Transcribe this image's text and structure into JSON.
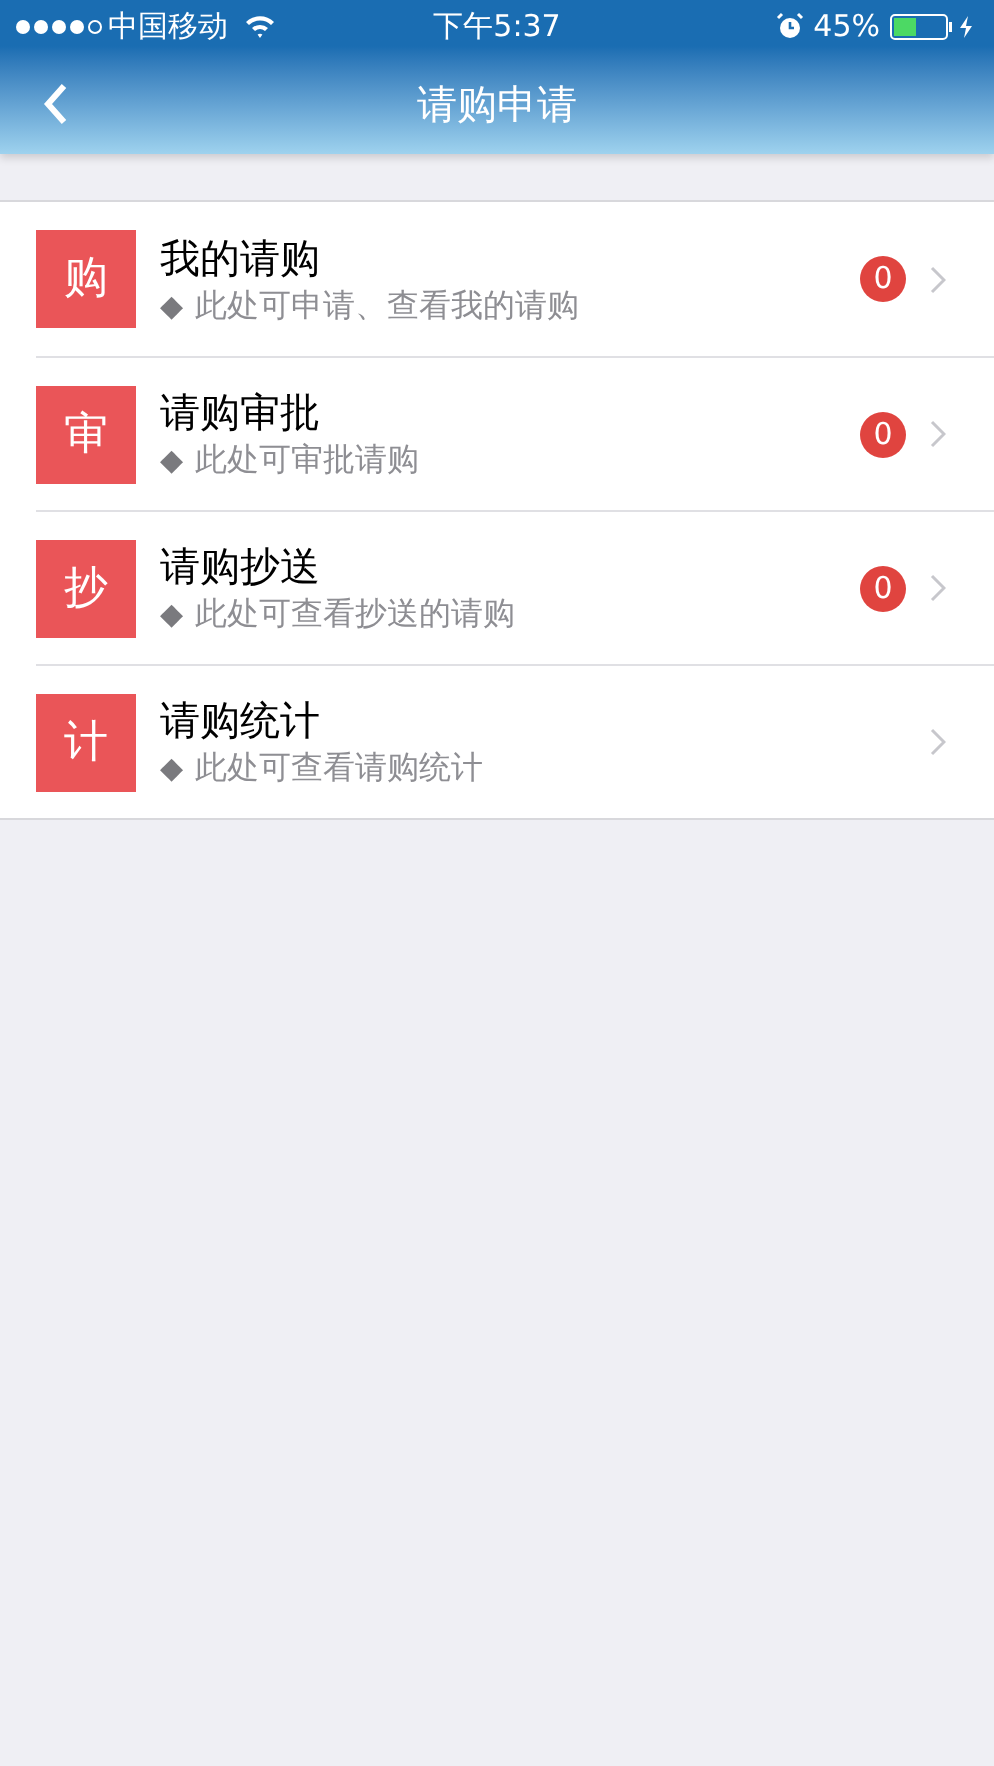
{
  "status_bar": {
    "carrier": "中国移动",
    "time": "下午5:37",
    "battery": "45%"
  },
  "nav_bar": {
    "title": "请购申请"
  },
  "items": [
    {
      "icon_char": "购",
      "title": "我的请购",
      "marker": "◆",
      "subtitle": "此处可申请、查看我的请购",
      "badge": "0"
    },
    {
      "icon_char": "审",
      "title": "请购审批",
      "marker": "◆",
      "subtitle": "此处可审批请购",
      "badge": "0"
    },
    {
      "icon_char": "抄",
      "title": "请购抄送",
      "marker": "◆",
      "subtitle": "此处可查看抄送的请购",
      "badge": "0"
    },
    {
      "icon_char": "计",
      "title": "请购统计",
      "marker": "◆",
      "subtitle": "此处可查看请购统计"
    }
  ]
}
